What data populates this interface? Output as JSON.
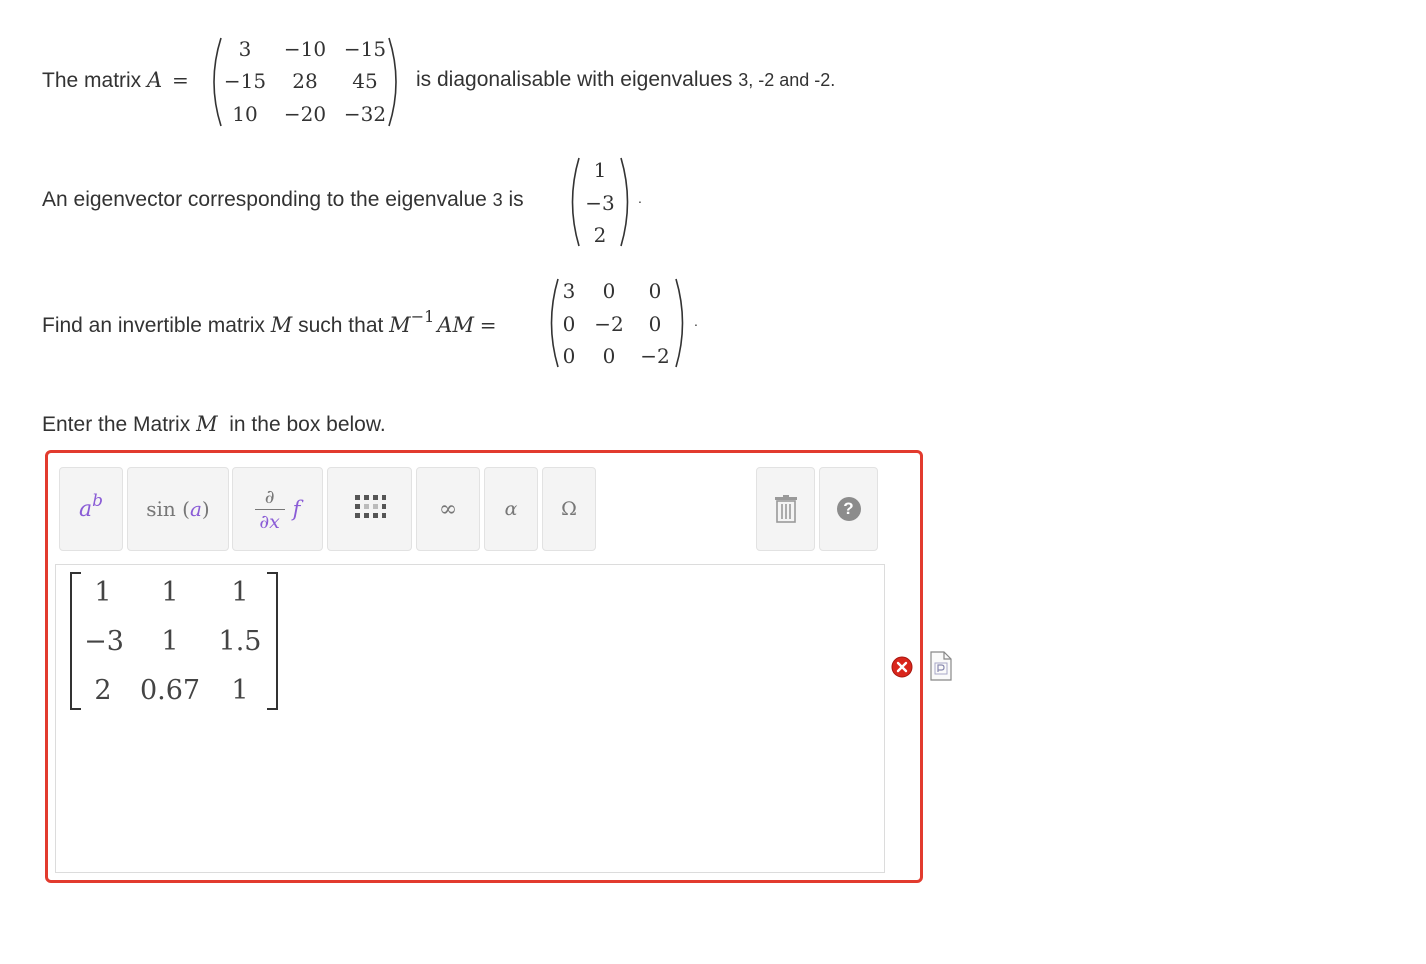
{
  "line1": {
    "prefix": "The matrix ",
    "var": "A",
    "eq": "=",
    "matrix": [
      [
        "3",
        "−10",
        "−15"
      ],
      [
        "−15",
        "28",
        "45"
      ],
      [
        "10",
        "−20",
        "−32"
      ]
    ],
    "text_mid": "is diagonalisable with eigenvalues ",
    "eigen_list": "3, -2 and -2."
  },
  "line2": {
    "prefix": "An eigenvector corresponding to the eigenvalue ",
    "eigenvalue": "3",
    "suffix": " is",
    "vector": [
      "1",
      "−3",
      "2"
    ],
    "end": "."
  },
  "line3": {
    "prefix": "Find an invertible matrix ",
    "var": "M",
    "mid": " such that ",
    "expr_M": "M",
    "expr_sup": "−1",
    "expr_AM": "AM",
    "eq": "=",
    "matrix": [
      [
        "3",
        "0",
        "0"
      ],
      [
        "0",
        "−2",
        "0"
      ],
      [
        "0",
        "0",
        "−2"
      ]
    ],
    "end": "."
  },
  "line4": {
    "prefix": "Enter the Matrix ",
    "var": "M",
    "suffix": "in the box below."
  },
  "toolbar": {
    "power_base": "a",
    "power_exp": "b",
    "sin_label": "sin",
    "sin_arg": "a",
    "deriv_num": "∂",
    "deriv_den": "∂x",
    "deriv_f": "f",
    "infinity": "∞",
    "alpha": "α",
    "omega": "Ω",
    "help": "?"
  },
  "answer_matrix": [
    [
      "1",
      "1",
      "1"
    ],
    [
      "−3",
      "1",
      "1.5"
    ],
    [
      "2",
      "0.67",
      "1"
    ]
  ],
  "colors": {
    "error_border": "#e23b2e",
    "toolbar_bg": "#f4f4f4",
    "accent_purple": "#8a5cd6"
  }
}
